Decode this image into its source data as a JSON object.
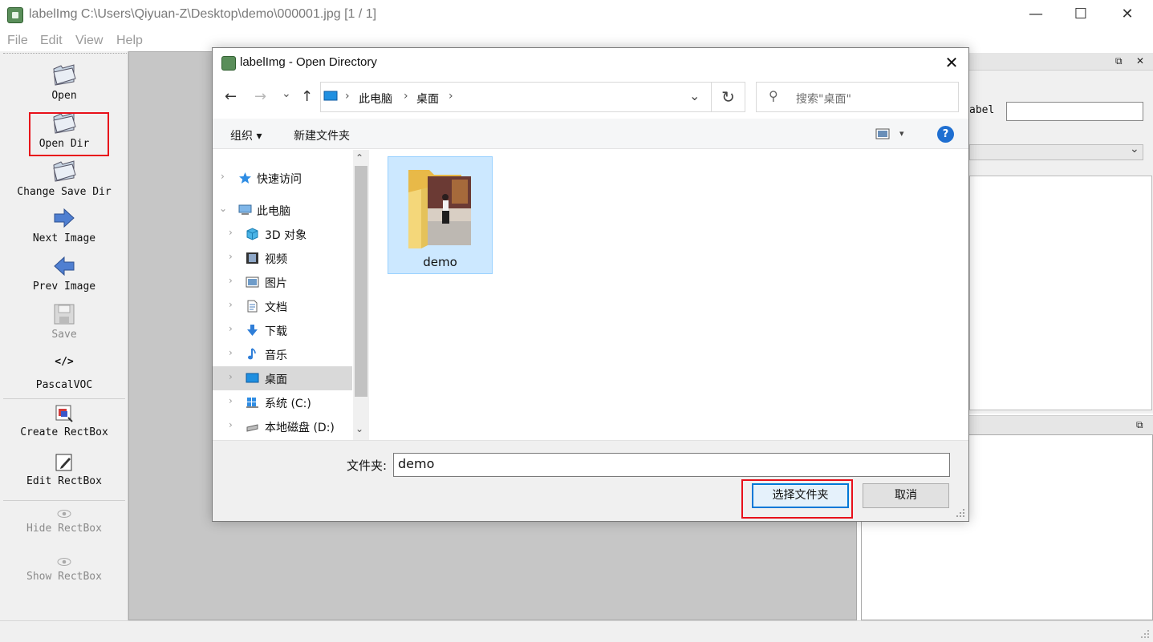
{
  "window": {
    "title": "labelImg C:\\Users\\Qiyuan-Z\\Desktop\\demo\\000001.jpg [1 / 1]",
    "minimize_glyph": "—",
    "maximize_glyph": "☐",
    "close_glyph": "✕"
  },
  "menu": [
    "File",
    "Edit",
    "View",
    "Help"
  ],
  "toolbar": {
    "open": "Open",
    "open_dir": "Open Dir",
    "change_save_dir": "Change Save Dir",
    "next_image": "Next Image",
    "prev_image": "Prev Image",
    "save": "Save",
    "format_icon": "</>",
    "format": "PascalVOC",
    "create_rectbox": "Create RectBox",
    "edit_rectbox": "Edit RectBox",
    "hide_rectbox": "Hide RectBox",
    "show_rectbox": "Show RectBox"
  },
  "right_panel": {
    "label_text": "abel",
    "dock_float": "⧉",
    "dock_close": "✕",
    "combo_arrow": "⌄"
  },
  "dialog": {
    "title": "labelImg - Open Directory",
    "close_glyph": "✕",
    "nav": {
      "back": "←",
      "forward": "→",
      "recent": "⌄",
      "up": "↑"
    },
    "address": [
      "此电脑",
      "桌面"
    ],
    "address_sep": "›",
    "address_dropdown": "⌄",
    "refresh": "↻",
    "search_placeholder": "搜索\"桌面\"",
    "search_icon": "⚲",
    "organize": "组织 ▾",
    "new_folder": "新建文件夹",
    "view_menu": "▾",
    "help": "?",
    "nav_items": [
      {
        "label": "快速访问",
        "icon": "star-icon"
      },
      {
        "label": "此电脑",
        "icon": "pc-icon"
      },
      {
        "label": "3D 对象",
        "icon": "cube-icon"
      },
      {
        "label": "视频",
        "icon": "video-icon"
      },
      {
        "label": "图片",
        "icon": "picture-icon"
      },
      {
        "label": "文档",
        "icon": "document-icon"
      },
      {
        "label": "下载",
        "icon": "download-icon"
      },
      {
        "label": "音乐",
        "icon": "music-icon"
      },
      {
        "label": "桌面",
        "icon": "desktop-icon"
      },
      {
        "label": "系统 (C:)",
        "icon": "windows-drive-icon"
      },
      {
        "label": "本地磁盘 (D:)",
        "icon": "drive-icon"
      }
    ],
    "nav_expand": "›",
    "nav_collapse": "⌄",
    "scroll_up": "⌃",
    "scroll_down": "⌄",
    "folders": [
      {
        "name": "demo"
      }
    ],
    "folder_field_label": "文件夹:",
    "folder_field_value": "demo",
    "ok_label": "选择文件夹",
    "cancel_label": "取消"
  },
  "colors": {
    "highlight_box": "#e8101a",
    "selection": "#cce8ff",
    "accent": "#0078d7"
  }
}
